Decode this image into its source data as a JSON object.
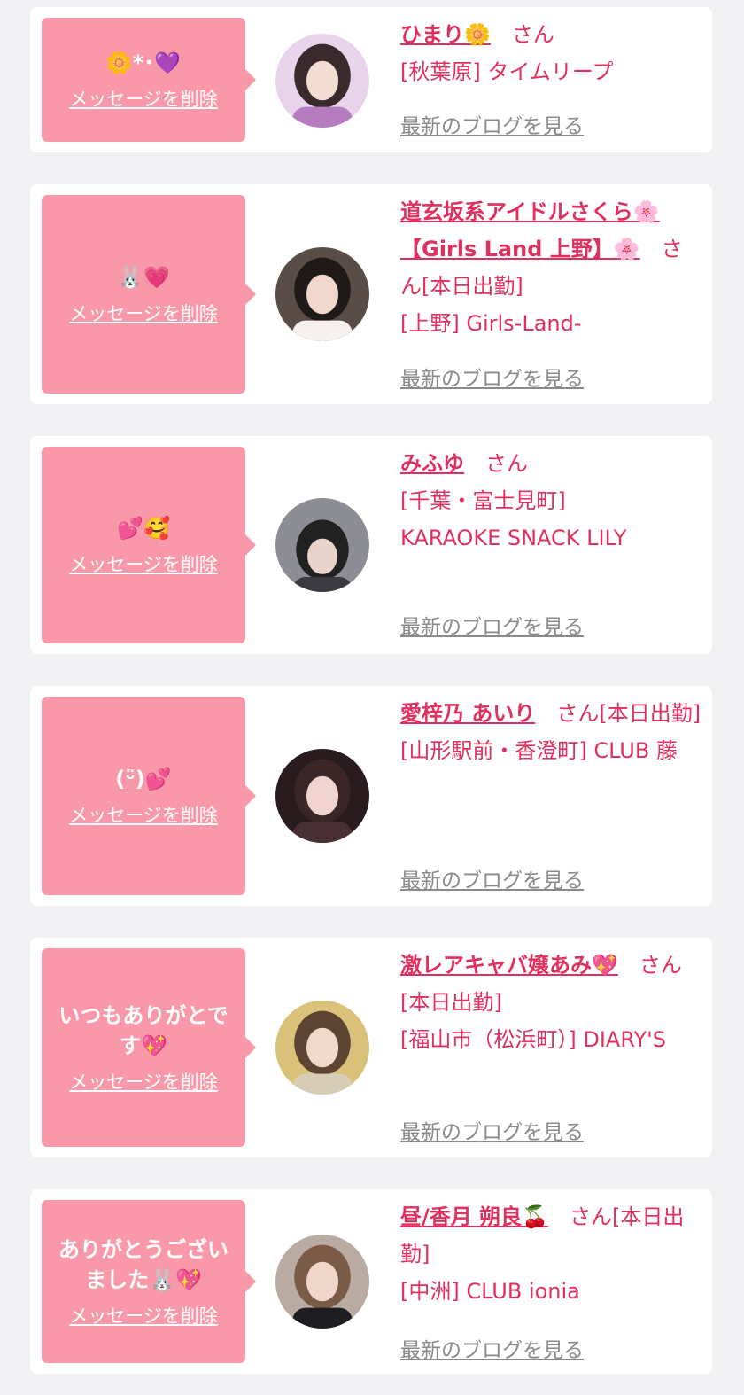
{
  "common": {
    "delete_label": "メッセージを削除",
    "blog_label": "最新のブログを見る",
    "honorific": "さん"
  },
  "cards": [
    {
      "message": "🌼*･💜",
      "name": "ひまり🌼",
      "status": "",
      "shop": "[秋葉原] タイムリープ",
      "avatar": {
        "bg": "#e9d3ea",
        "hair": "#3b2a2d",
        "skin": "#f4dcd3",
        "cloth": "#b67cc0"
      }
    },
    {
      "message": "🐰💗",
      "name": "道玄坂系アイドルさくら🌸【Girls Land 上野】🌸",
      "status": "[本日出勤]",
      "shop": "[上野] Girls-Land-",
      "avatar": {
        "bg": "#5a4c46",
        "hair": "#1f1a18",
        "skin": "#f1d6cb",
        "cloth": "#f6f1ef"
      }
    },
    {
      "message": "💕🥰",
      "name": "みふゆ",
      "status": "",
      "shop": "[千葉・富士見町] KARAOKE SNACK LILY",
      "avatar": {
        "bg": "#8d8d96",
        "hair": "#222222",
        "skin": "#e9d2c9",
        "cloth": "#3a3a40"
      }
    },
    {
      "message": "(ᵕ̈)💕",
      "name": "愛梓乃 あいり",
      "status": "[本日出勤]",
      "shop": "[山形駅前・香澄町] CLUB 藤",
      "avatar": {
        "bg": "#2a1c1e",
        "hair": "#3b2526",
        "skin": "#f0d3cf",
        "cloth": "#4a3034"
      }
    },
    {
      "message": "いつもありがとです💖",
      "name": "激レアキャバ嬢あみ💖",
      "status": "[本日出勤]",
      "shop": "[福山市（松浜町）] DIARY'S",
      "avatar": {
        "bg": "#d9c17a",
        "hair": "#5c4533",
        "skin": "#f2d8c8",
        "cloth": "#d7cdb6"
      }
    },
    {
      "message": "ありがとうございました🐰💖",
      "name": "昼/香月 朔良🍒",
      "status": "[本日出勤]",
      "shop": "[中洲] CLUB ionia",
      "avatar": {
        "bg": "#b9aba2",
        "hair": "#7a5b46",
        "skin": "#f0d6c8",
        "cloth": "#1e1e22"
      }
    }
  ]
}
